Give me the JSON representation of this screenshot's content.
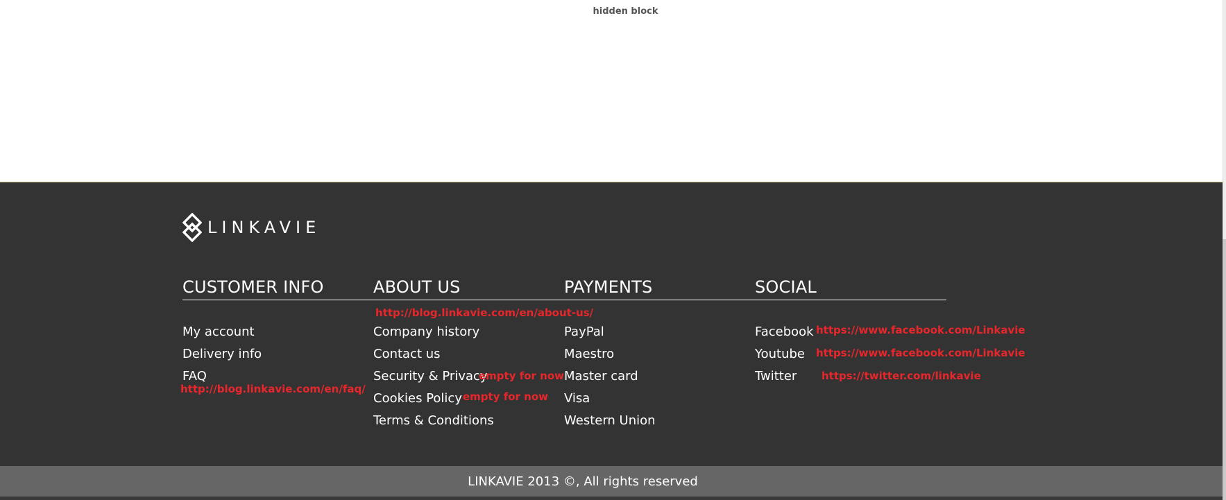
{
  "top": {
    "hidden_block_label": "hidden block"
  },
  "footer": {
    "logo_text": "LINKAVIE",
    "columns": [
      {
        "heading": "CUSTOMER INFO",
        "links": [
          "My account",
          "Delivery info",
          "FAQ"
        ]
      },
      {
        "heading": "ABOUT US",
        "links": [
          "Company history",
          "Contact us",
          "Security & Privacy",
          "Cookies Policy",
          "Terms & Conditions"
        ]
      },
      {
        "heading": "PAYMENTS",
        "links": [
          "PayPal",
          "Maestro",
          "Master card",
          "Visa",
          "Western Union"
        ]
      },
      {
        "heading": "SOCIAL",
        "links": [
          "Facebook",
          "Youtube",
          "Twitter"
        ]
      }
    ],
    "annotations": {
      "about_url": "http://blog.linkavie.com/en/about-us/",
      "faq_url": "http://blog.linkavie.com/en/faq/",
      "security_note": "empty for now",
      "cookies_note": "empty for now",
      "facebook_url": "https://www.facebook.com/Linkavie",
      "youtube_url": "https://www.facebook.com/Linkavie",
      "twitter_url": "https://twitter.com/linkavie"
    },
    "copyright": "LINKAVIE 2013 ©, All rights reserved"
  },
  "colors": {
    "footer_bg": "#333333",
    "bottom_bar_bg": "#666666",
    "annotation_red": "#e8262b",
    "text_white": "#ffffff"
  }
}
